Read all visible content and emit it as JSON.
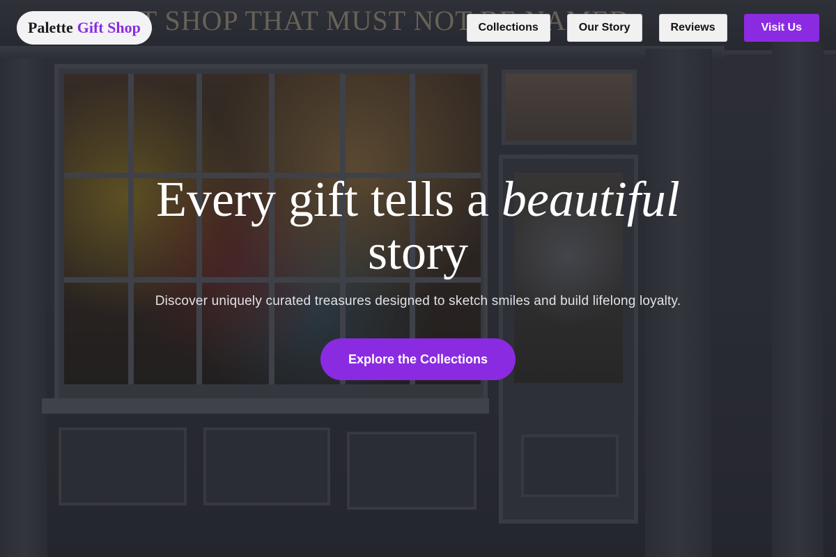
{
  "brand": {
    "name_part1": "Palette",
    "name_part2": "Gift Shop"
  },
  "nav": {
    "items": [
      {
        "label": "Collections"
      },
      {
        "label": "Our Story"
      },
      {
        "label": "Reviews"
      }
    ],
    "primary_label": "Visit Us"
  },
  "hero": {
    "headline_part1": "Every gift tells a",
    "headline_emphasis": "beautiful",
    "headline_part2": "story",
    "subtitle": "Discover uniquely curated treasures designed to sketch smiles and build lifelong loyalty.",
    "cta_label": "Explore the Collections"
  },
  "background": {
    "sign_text": "THAT SHOP THAT MUST NOT BE NAMED"
  },
  "colors": {
    "accent": "#8a2be2",
    "nav_button_bg": "#f1f1f2",
    "brand_pill_bg": "#f3f3f5"
  }
}
